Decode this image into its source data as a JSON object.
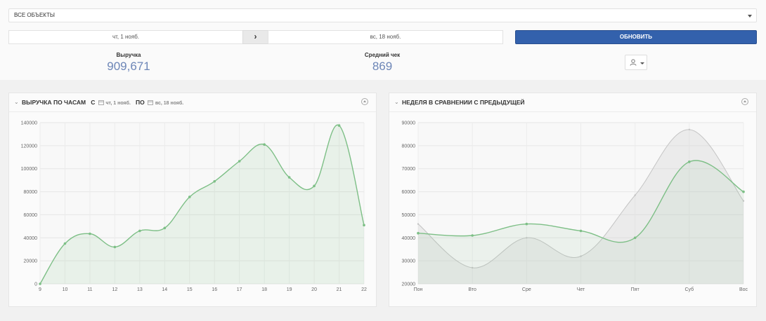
{
  "filters": {
    "object_select": "ВСЕ ОБЪЕКТЫ",
    "date_from": "чт, 1 нояб.",
    "date_to": "вс, 18 нояб.",
    "refresh_label": "ОБНОВИТЬ"
  },
  "stats": {
    "revenue_label": "Выручка",
    "revenue_value": "909,671",
    "avg_check_label": "Средний чек",
    "avg_check_value": "869"
  },
  "panels": {
    "hourly": {
      "title": "ВЫРУЧКА ПО ЧАСАМ",
      "from_word": "С",
      "to_word": "ПО",
      "date_from": "чт, 1 нояб.",
      "date_to": "вс, 18 нояб."
    },
    "weekly": {
      "title": "НЕДЕЛЯ В СРАВНЕНИИ С ПРЕДЫДУЩЕЙ"
    }
  },
  "colors": {
    "accent": "#3361ac",
    "stat_value": "#6d86b7",
    "series_current": "#7dbf86",
    "series_previous": "#c4c4c4"
  },
  "chart_data": [
    {
      "type": "area",
      "title": "ВЫРУЧКА ПО ЧАСАМ",
      "x": [
        "9",
        "10",
        "11",
        "12",
        "13",
        "14",
        "15",
        "16",
        "17",
        "18",
        "19",
        "20",
        "21",
        "22"
      ],
      "series": [
        {
          "values": [
            0,
            35000,
            43500,
            32000,
            46000,
            48500,
            75500,
            89000,
            106500,
            121000,
            92500,
            85000,
            137500,
            51000
          ]
        }
      ],
      "yticks": [
        "0",
        "20000",
        "40000",
        "60000",
        "80000",
        "100000",
        "120000",
        "140000"
      ],
      "ylim": [
        0,
        140000
      ],
      "grid": true
    },
    {
      "type": "area",
      "title": "НЕДЕЛЯ В СРАВНЕНИИ С ПРЕДЫДУЩЕЙ",
      "categories": [
        "Пон",
        "Вто",
        "Сре",
        "Чет",
        "Пят",
        "Суб",
        "Вос"
      ],
      "series": [
        {
          "values": [
            42000,
            41000,
            46000,
            43000,
            40000,
            73000,
            60000
          ]
        },
        {
          "values": [
            46000,
            27000,
            40000,
            32000,
            58500,
            87000,
            56000
          ]
        }
      ],
      "yticks": [
        "20000",
        "30000",
        "40000",
        "50000",
        "60000",
        "70000",
        "80000",
        "90000"
      ],
      "ylim": [
        20000,
        90000
      ],
      "grid": true
    }
  ]
}
